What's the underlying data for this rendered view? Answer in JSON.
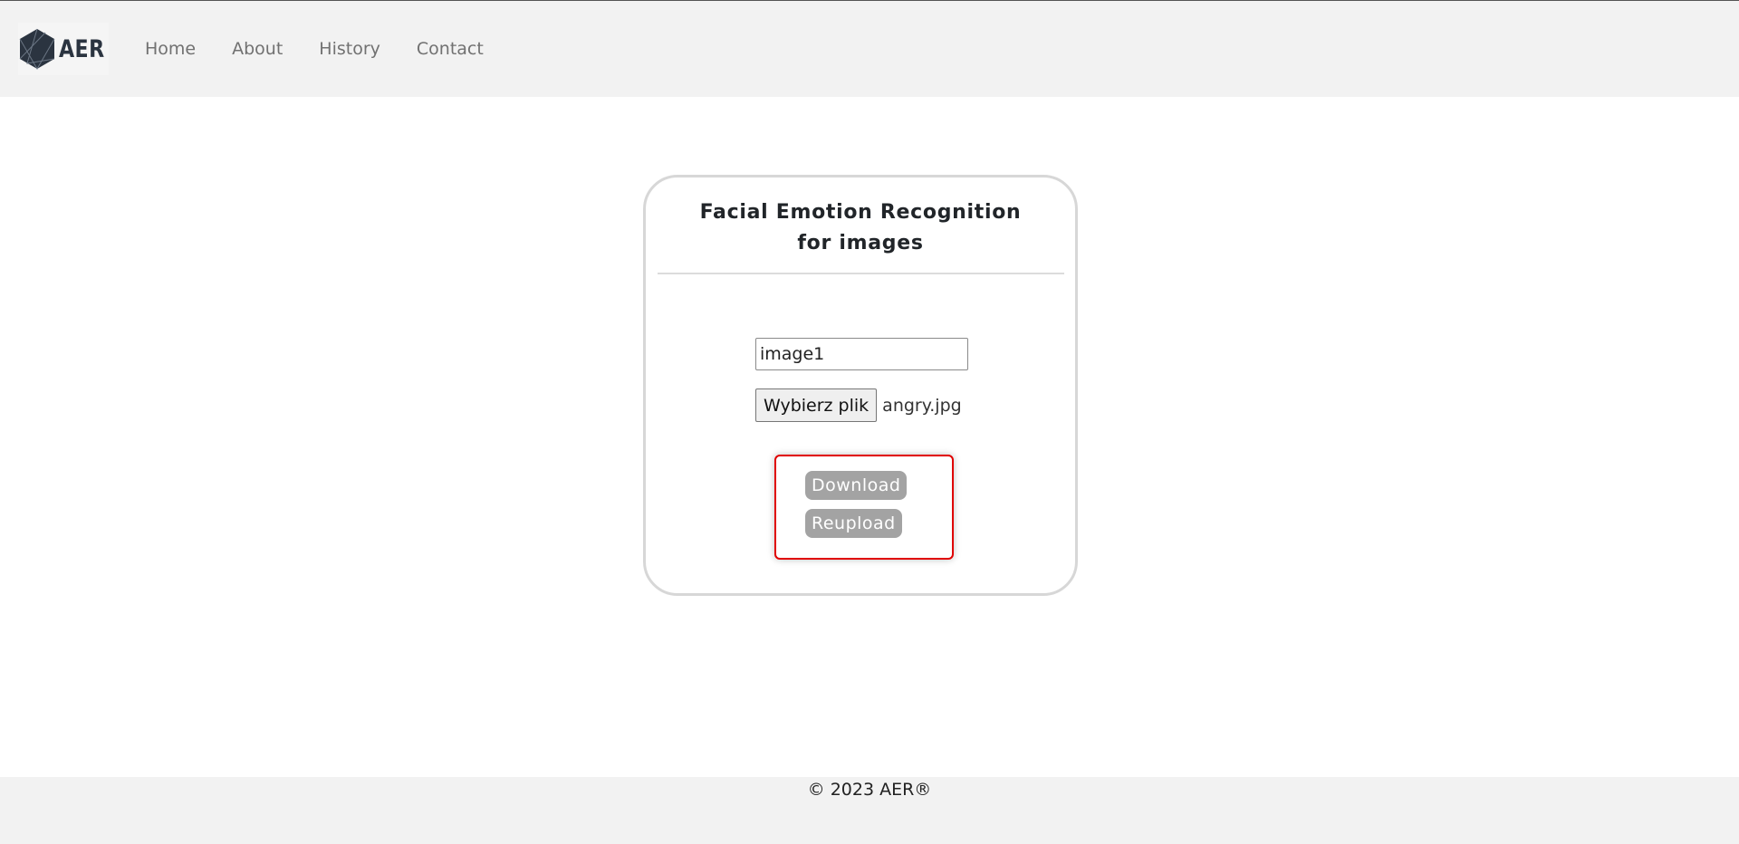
{
  "navbar": {
    "brand_text": "AER",
    "logo_icon": "polyhedron-logo-icon",
    "links": [
      {
        "label": "Home"
      },
      {
        "label": "About"
      },
      {
        "label": "History"
      },
      {
        "label": "Contact"
      }
    ]
  },
  "card": {
    "title": "Facial Emotion Recognition for images",
    "name_input": {
      "value": "image1"
    },
    "file_input": {
      "button_label": "Wybierz plik",
      "file_name": "angry.jpg"
    },
    "actions": {
      "download_label": "Download",
      "reupload_label": "Reupload",
      "highlight_color": "#e00000"
    }
  },
  "footer": {
    "text": "© 2023 AER®"
  },
  "colors": {
    "navbar_bg": "#f2f2f2",
    "nav_link": "#717171",
    "button_gray": "#a3a3a3",
    "card_border": "#d7d7d7"
  }
}
